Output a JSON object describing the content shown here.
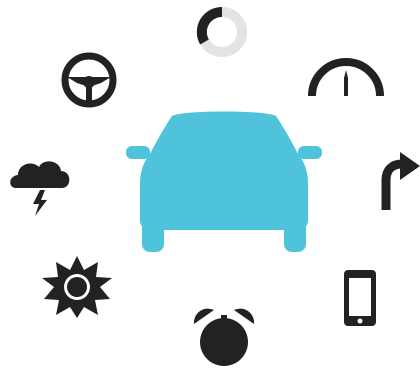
{
  "colors": {
    "car": "#4ec3db",
    "icon": "#222222",
    "ring_light": "#e3e3e3",
    "background": "#ffffff"
  },
  "car": {
    "icon": "car-front-icon"
  },
  "icons": [
    {
      "name": "progress-ring-icon"
    },
    {
      "name": "speedometer-icon"
    },
    {
      "name": "turn-right-arrow-icon"
    },
    {
      "name": "smartphone-icon"
    },
    {
      "name": "alarm-clock-icon"
    },
    {
      "name": "sun-burst-icon"
    },
    {
      "name": "thunderstorm-cloud-icon"
    },
    {
      "name": "steering-wheel-icon"
    }
  ]
}
